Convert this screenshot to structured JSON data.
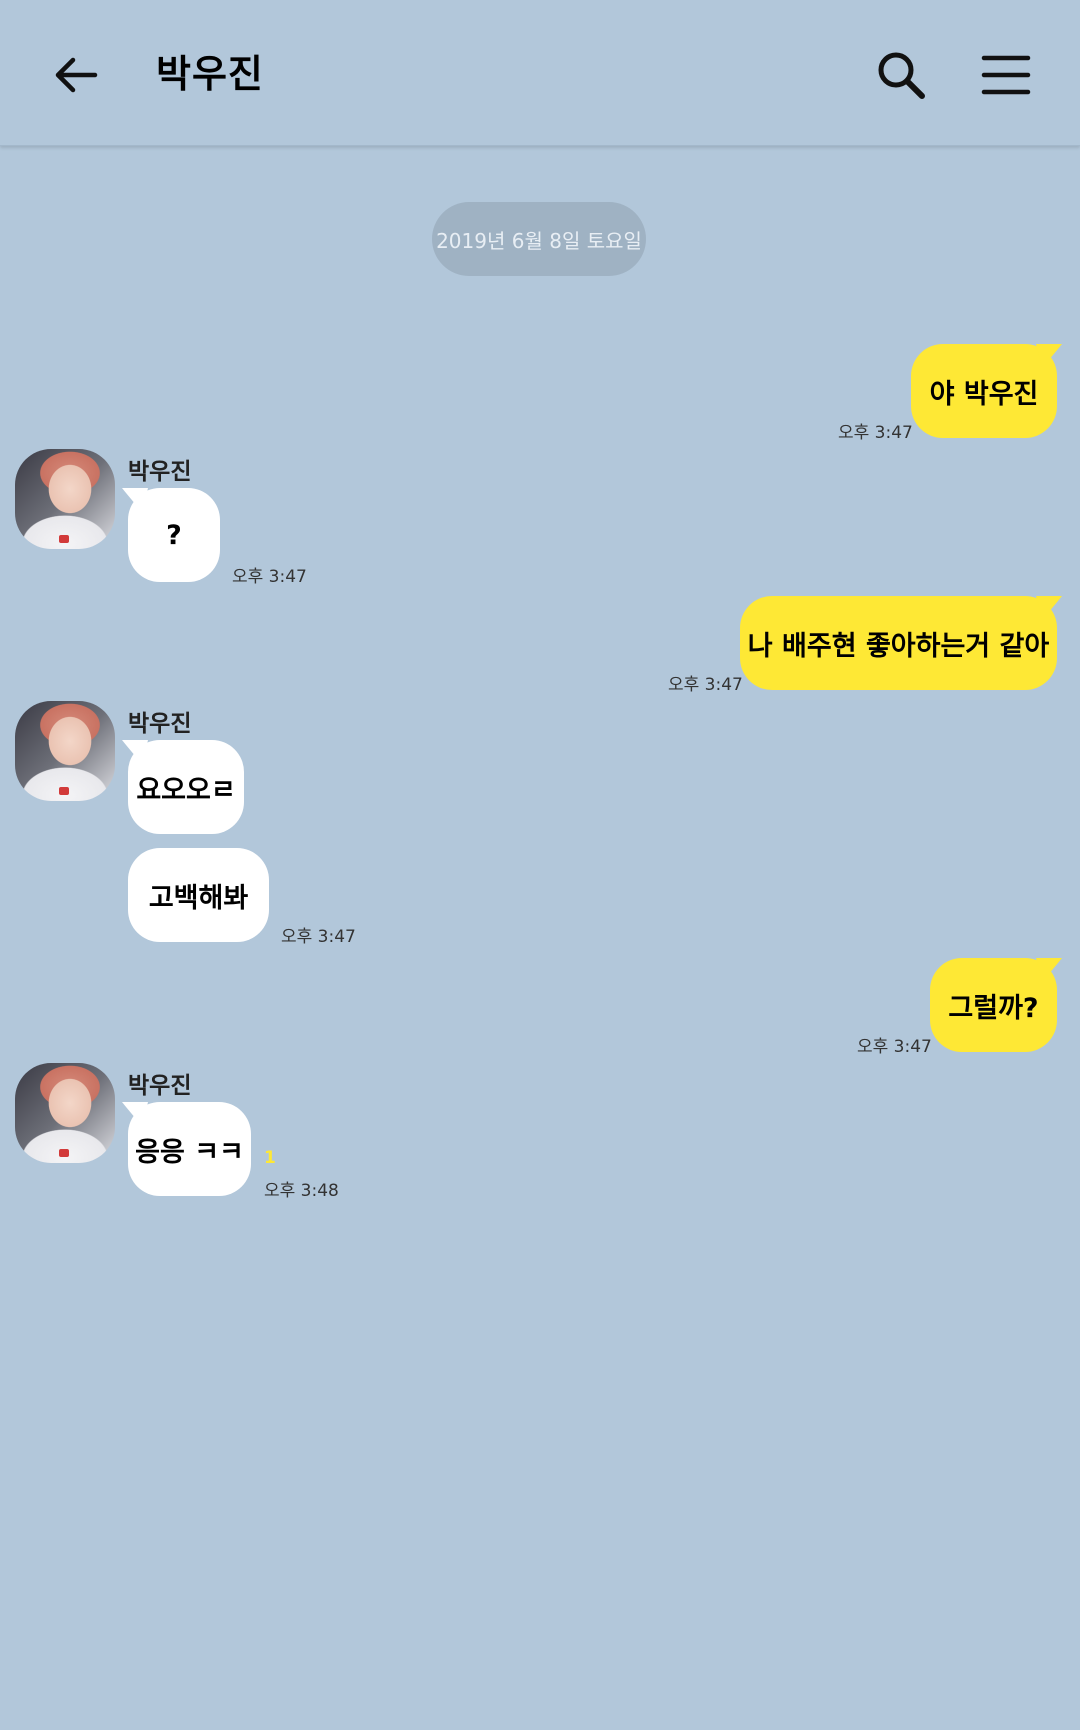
{
  "header": {
    "title": "박우진"
  },
  "date_divider": "2019년 6월 8일 토요일",
  "messages": [
    {
      "sender": "me",
      "text": "야 박우진",
      "time": "오후 3:47"
    },
    {
      "sender": "박우진",
      "text": "?",
      "time": "오후 3:47"
    },
    {
      "sender": "me",
      "text": "나 배주현  좋아하는거 같아",
      "time": "오후 3:47"
    },
    {
      "sender": "박우진",
      "text": "요오오ㄹ"
    },
    {
      "sender": "박우진",
      "text": "고백해봐",
      "time": "오후 3:47"
    },
    {
      "sender": "me",
      "text": "그럴까?",
      "time": "오후 3:47"
    },
    {
      "sender": "박우진",
      "text": "응응 ㅋㅋ",
      "time": "오후 3:48",
      "unread": "1"
    }
  ],
  "colors": {
    "background": "#b2c7da",
    "my_bubble": "#fee835",
    "their_bubble": "#ffffff",
    "date_pill": "#9fb2c3"
  }
}
